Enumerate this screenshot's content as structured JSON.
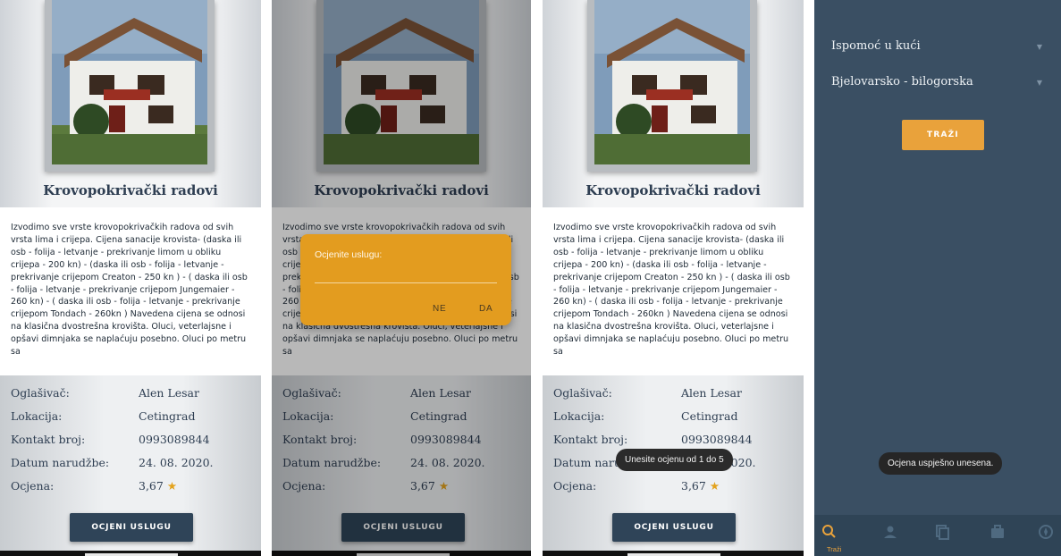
{
  "listing": {
    "title": "Krovopokrivački radovi",
    "description": "Izvodimo sve vrste krovopokrivačkih radova od svih vrsta lima i crijepa.  Cijena sanacije krovista- (daska ili osb - folija - letvanje - prekrivanje limom u obliku crijepa - 200 kn)  - (daska ili osb - folija - letvanje - prekrivanje crijepom Creaton - 250 kn ) - ( daska ili osb - folija - letvanje - prekrivanje crijepom Jungemaier - 260 kn) - ( daska ili osb - folija - letvanje - prekrivanje crijepom Tondach - 260kn )  Navedena cijena se odnosi na klasična dvostrešna krovišta.  Oluci, veterlajsne i opšavi dimnjaka se naplaćuju posebno.  Oluci po metru sa",
    "details": {
      "advertiser_label": "Oglašivač:",
      "advertiser_value": "Alen Lesar",
      "location_label": "Lokacija:",
      "location_value": "Cetingrad",
      "phone_label": "Kontakt broj:",
      "phone_value": "0993089844",
      "date_label": "Datum narudžbe:",
      "date_value": "24. 08. 2020.",
      "rating_label": "Ocjena:",
      "rating_value": "3,67",
      "rating_icon": "star-icon"
    },
    "rate_button": "OCJENI USLUGU"
  },
  "dialog": {
    "title": "Ocjenite uslugu:",
    "input_value": "",
    "no_label": "NE",
    "yes_label": "DA"
  },
  "toast_rate_range": "Unesite ocjenu od 1 do 5",
  "search_screen": {
    "category_select": "Ispomoć u kući",
    "county_select": "Bjelovarsko - bilogorska",
    "search_button": "TRAŽI",
    "toast_success": "Ocjena uspješno unesena.",
    "nav": [
      {
        "icon": "search-icon",
        "label": "Traži"
      },
      {
        "icon": "person-icon",
        "label": ""
      },
      {
        "icon": "copy-icon",
        "label": ""
      },
      {
        "icon": "briefcase-icon",
        "label": ""
      },
      {
        "icon": "compass-icon",
        "label": ""
      }
    ]
  },
  "colors": {
    "accent": "#e9a23b",
    "dialog": "#e39c1f",
    "navy": "#2f4458",
    "dark_bg": "#3a4f63"
  }
}
